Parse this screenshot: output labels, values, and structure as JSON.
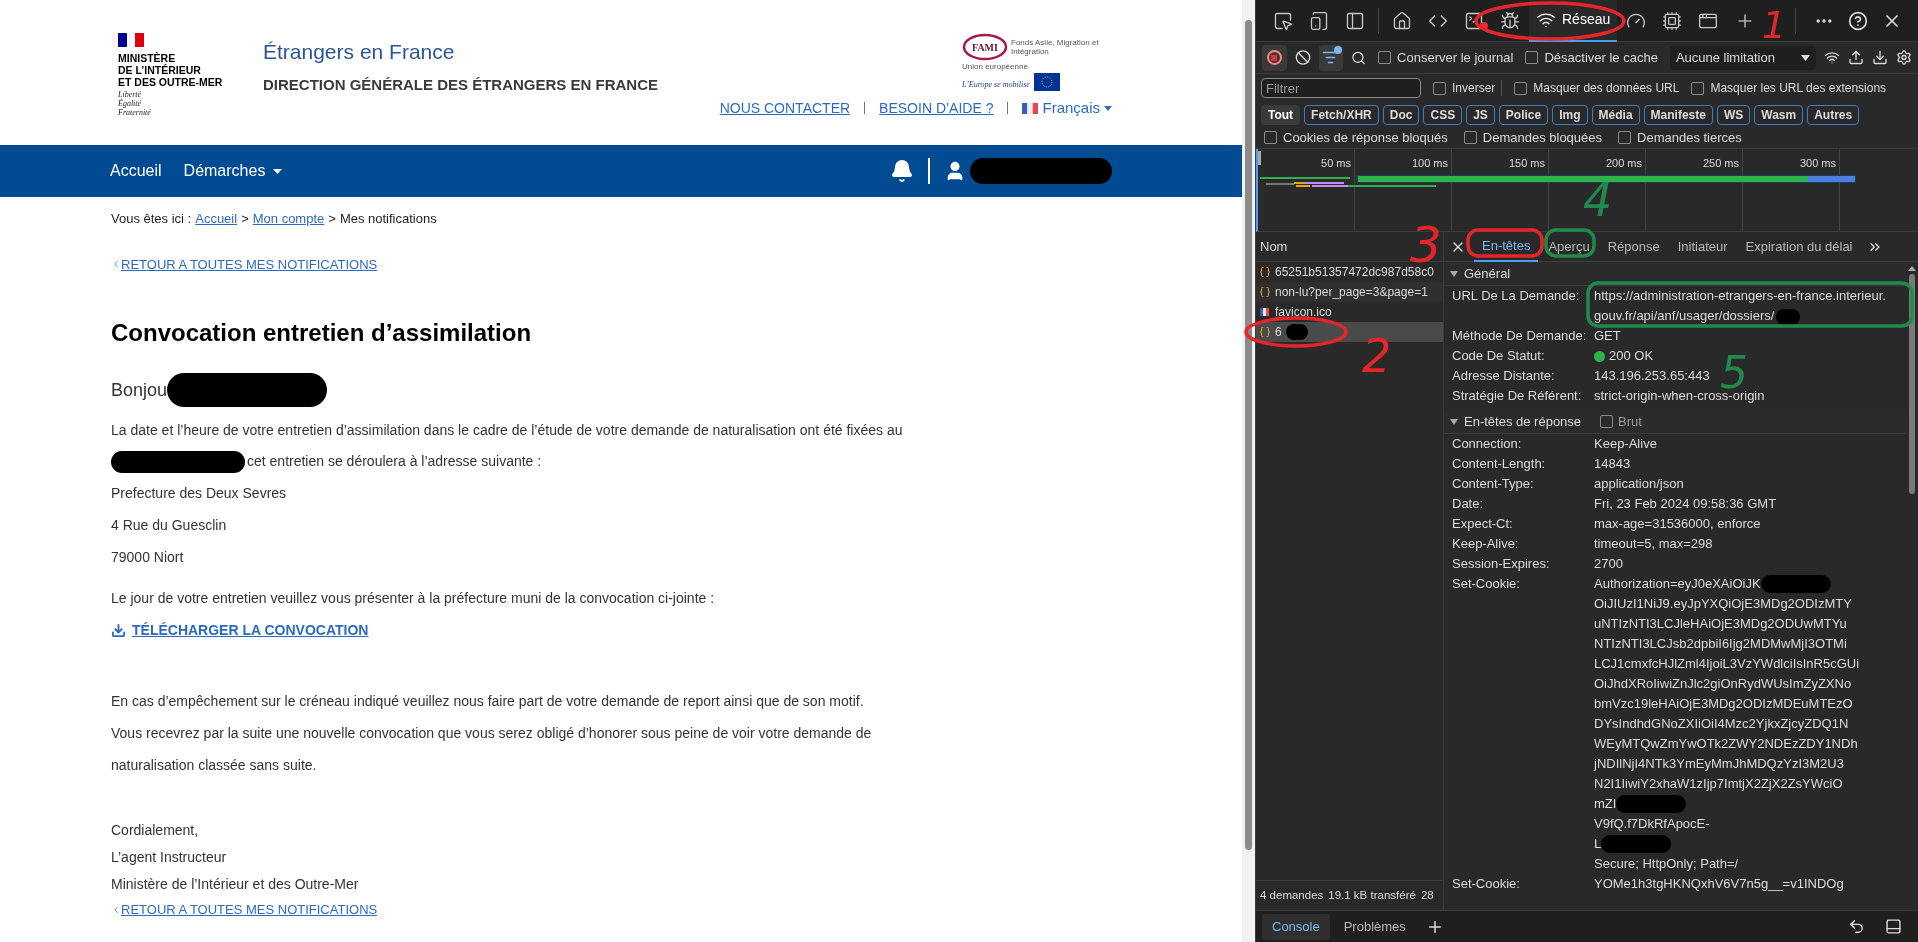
{
  "page": {
    "ministry": {
      "lines": [
        "MINISTÈRE",
        "DE L’INTÉRIEUR",
        "ET DES OUTRE-MER"
      ],
      "motto": [
        "Liberté",
        "Égalité",
        "Fraternité"
      ]
    },
    "site_title": "Étrangers en France",
    "site_subtitle": "DIRECTION GÉNÉRALE DES ÉTRANGERS EN FRANCE",
    "partner": {
      "name": "FAMI",
      "caption": "Fonds Asile, Migration et Intégration",
      "union": "Union européenne",
      "slogan": "L’Europe se mobilise"
    },
    "top_links": [
      {
        "label": "NOUS CONTACTER"
      },
      {
        "label": "BESOIN D’AIDE ?"
      }
    ],
    "language": "Français",
    "nav": [
      {
        "label": "Accueil",
        "dropdown": false
      },
      {
        "label": "Démarches",
        "dropdown": true
      }
    ],
    "user": {
      "redacted": true
    },
    "breadcrumb": {
      "prefix": "Vous êtes ici :",
      "items": [
        {
          "label": "Accueil",
          "link": true
        },
        {
          "separator": ">",
          "label": "Mon compte",
          "link": true
        },
        {
          "separator": ">",
          "label": "Mes notifications",
          "link": false
        }
      ]
    },
    "back_link": "RETOUR A TOUTES MES NOTIFICATIONS",
    "heading": "Convocation entretien d’assimilation",
    "greeting": {
      "text": "Bonjou",
      "redacted": true
    },
    "intro": "La date et l’heure de votre entretien d’assimilation dans le cadre de l’étude de votre demande de naturalisation ont été fixées au",
    "intro_2": {
      "text": "cet entretien se déroulera à l’adresse suivante :",
      "redacted": true
    },
    "address": [
      "Prefecture des Deux Sevres",
      "4 Rue du Guesclin",
      "79000 Niort"
    ],
    "instruction": "Le jour de votre entretien veuillez vous présenter à la préfecture muni de la convocation ci-jointe :",
    "download_link": "TÉLÉCHARGER LA CONVOCATION",
    "notice": [
      "En cas d’empêchement sur le créneau indiqué veuillez nous faire part de votre demande de report ainsi que de son motif.",
      "Vous recevrez par la suite une nouvelle convocation que vous serez obligé d’honorer sous peine de voir votre demande de",
      "naturalisation classée sans suite."
    ],
    "signature": [
      "Cordialement,",
      "L’agent Instructeur",
      "Ministère de l’Intérieur et des Outre-Mer"
    ],
    "back_link_bottom": "RETOUR A TOUTES MES NOTIFICATIONS"
  },
  "devtools": {
    "tabs": [
      {
        "kind": "inspect",
        "selected": false
      },
      {
        "kind": "device",
        "selected": false
      },
      {
        "kind": "sidebar",
        "selected": false
      },
      {
        "kind": "welcome",
        "selected": false
      },
      {
        "kind": "elements",
        "selected": false
      },
      {
        "kind": "console",
        "selected": false,
        "error": true
      },
      {
        "kind": "sources",
        "selected": false
      },
      {
        "kind": "network",
        "label": "Réseau",
        "selected": true
      },
      {
        "kind": "performance",
        "selected": false
      },
      {
        "kind": "memory",
        "selected": false
      },
      {
        "kind": "application",
        "selected": false
      }
    ],
    "toolbar": {
      "recording": true,
      "filter_active": true,
      "checkboxes": [
        {
          "label": "Conserver le journal",
          "checked": false
        },
        {
          "label": "Désactiver le cache",
          "checked": false
        }
      ],
      "throttling": "Aucune limitation"
    },
    "filter": {
      "placeholder": "Filtrer",
      "checkboxes": [
        {
          "label": "Inverser",
          "checked": false
        },
        {
          "label": "Masquer des données URL",
          "checked": false
        },
        {
          "label": "Masquer les URL des extensions",
          "checked": false
        }
      ]
    },
    "types": [
      {
        "label": "Tout",
        "selected": true
      },
      {
        "label": "Fetch/XHR",
        "selected": false
      },
      {
        "label": "Doc",
        "selected": false
      },
      {
        "label": "CSS",
        "selected": false
      },
      {
        "label": "JS",
        "selected": false
      },
      {
        "label": "Police",
        "selected": false
      },
      {
        "label": "Img",
        "selected": false
      },
      {
        "label": "Média",
        "selected": false
      },
      {
        "label": "Manifeste",
        "selected": false
      },
      {
        "label": "WS",
        "selected": false
      },
      {
        "label": "Wasm",
        "selected": false
      },
      {
        "label": "Autres",
        "selected": false
      }
    ],
    "blocked": [
      {
        "label": "Cookies de réponse bloqués",
        "checked": false
      },
      {
        "label": "Demandes bloquées",
        "checked": false
      },
      {
        "label": "Demandes tierces",
        "checked": false
      }
    ],
    "timeline": {
      "ticks": [
        "50 ms",
        "100 ms",
        "150 ms",
        "200 ms",
        "250 ms",
        "300 ms"
      ]
    },
    "requests": {
      "header": "Nom",
      "items": [
        {
          "name": "65251b51357472dc987d58c0",
          "kind": "fetch",
          "selected": false,
          "redacted": false
        },
        {
          "name": "non-lu?per_page=3&page=1",
          "kind": "fetch",
          "selected": false,
          "redacted": false
        },
        {
          "name": "favicon.ico",
          "kind": "image",
          "selected": false,
          "redacted": false
        },
        {
          "name": "6",
          "kind": "fetch",
          "selected": true,
          "redacted": true
        }
      ]
    },
    "detail_tabs": [
      {
        "label": "En-têtes",
        "selected": true
      },
      {
        "label": "Aperçu",
        "selected": false
      },
      {
        "label": "Réponse",
        "selected": false
      },
      {
        "label": "Initiateur",
        "selected": false
      },
      {
        "label": "Expiration du délai",
        "selected": false
      }
    ],
    "general": {
      "title": "Général",
      "expanded": true,
      "rows": [
        {
          "name": "URL De La Demande:",
          "value": "https://administration-etrangers-en-france.interieur.gouv.fr/api/anf/usager/dossiers/",
          "redacted": true
        },
        {
          "name": "Méthode De Demande:",
          "value": "GET",
          "redacted": false
        },
        {
          "name": "Code De Statut:",
          "value": "200 OK",
          "redacted": false,
          "color": "#2fb24c"
        },
        {
          "name": "Adresse Distante:",
          "value": "143.196.253.65:443",
          "redacted": false
        },
        {
          "name": "Stratégie De Référent:",
          "value": "strict-origin-when-cross-origin",
          "redacted": false
        }
      ]
    },
    "response_headers": {
      "title": "En-têtes de réponse",
      "expanded": true,
      "raw": {
        "label": "Brut",
        "checked": false
      },
      "rows": [
        {
          "name": "Connection:",
          "lines": [
            {
              "text": "Keep-Alive",
              "redacted": false
            }
          ]
        },
        {
          "name": "Content-Length:",
          "lines": [
            {
              "text": "14843",
              "redacted": false
            }
          ]
        },
        {
          "name": "Content-Type:",
          "lines": [
            {
              "text": "application/json",
              "redacted": false
            }
          ]
        },
        {
          "name": "Date:",
          "lines": [
            {
              "text": "Fri, 23 Feb 2024 09:58:36 GMT",
              "redacted": false
            }
          ]
        },
        {
          "name": "Expect-Ct:",
          "lines": [
            {
              "text": "max-age=31536000, enforce",
              "redacted": false
            }
          ]
        },
        {
          "name": "Keep-Alive:",
          "lines": [
            {
              "text": "timeout=5, max=298",
              "redacted": false
            }
          ]
        },
        {
          "name": "Session-Expires:",
          "lines": [
            {
              "text": "2700",
              "redacted": false
            }
          ]
        },
        {
          "name": "Set-Cookie:",
          "lines": [
            {
              "text": "Authorization=eyJ0eXAiOiJK",
              "redacted": true
            },
            {
              "text": "OiJIUzI1NiJ9.eyJpYXQiOjE3MDg2ODIzMTY",
              "redacted": false
            },
            {
              "text": "uNTIzNTI3LCJleHAiOjE3MDg2ODUwMTYu",
              "redacted": false
            },
            {
              "text": "NTIzNTI3LCJsb2dpbiI6Ijg2MDMwMjI3OTMi",
              "redacted": false
            },
            {
              "text": "LCJ1cmxfcHJlZml4IjoiL3VzYWdlciIsInR5cGUi",
              "redacted": false
            },
            {
              "text": "OiJhdXRoIiwiZnJlc2giOnRydWUsImZyZXNo",
              "redacted": false
            },
            {
              "text": "bmVzc19leHAiOjE3MDg2ODIzMDEuMTEzO",
              "redacted": false
            },
            {
              "text": "DYsIndhdGNoZXIiOiI4Mzc2YjkxZjcyZDQ1N",
              "redacted": false
            },
            {
              "text": "WEyMTQwZmYwOTk2ZWY2NDEzZDY1NDh",
              "redacted": false
            },
            {
              "text": "jNDIlNjI4NTk3YmEyMmJhMDQzYzI3M2U3",
              "redacted": false
            },
            {
              "text": "N2I1IiwiY2xhaW1zIjp7ImtjX2ZjX2ZsYWciO",
              "redacted": false
            },
            {
              "text": "mZI",
              "redacted": true
            },
            {
              "text": "V9fQ.f7DkRfApocE-",
              "redacted": false
            },
            {
              "text": "L",
              "redacted": true
            },
            {
              "text": "Secure; HttpOnly; Path=/",
              "redacted": false
            }
          ]
        },
        {
          "name": "Set-Cookie:",
          "lines": [
            {
              "text": "YOMe1h3tgHKNQxhV6V7n5g__=v1INDOg",
              "redacted": false
            }
          ]
        }
      ]
    },
    "status": [
      "4 demandes",
      "19.1 kB transféré",
      "28"
    ],
    "drawer_tabs": [
      {
        "label": "Console",
        "selected": true
      },
      {
        "label": "Problèmes",
        "selected": false
      }
    ]
  },
  "annotations": [
    {
      "kind": "ellipse",
      "color": "#e3262a"
    },
    {
      "kind": "number",
      "label": "1",
      "color": "#e3262a"
    },
    {
      "kind": "ellipse",
      "color": "#e3262a"
    },
    {
      "kind": "number",
      "label": "2",
      "color": "#e3262a"
    },
    {
      "kind": "number",
      "label": "3",
      "color": "#e3262a"
    },
    {
      "kind": "box",
      "color": "#e3262a"
    },
    {
      "kind": "number",
      "label": "4",
      "color": "#1f8a4c"
    },
    {
      "kind": "box",
      "color": "#1f8a4c"
    },
    {
      "kind": "box",
      "color": "#1f8a4c"
    },
    {
      "kind": "number",
      "label": "5",
      "color": "#1f8a4c"
    }
  ]
}
